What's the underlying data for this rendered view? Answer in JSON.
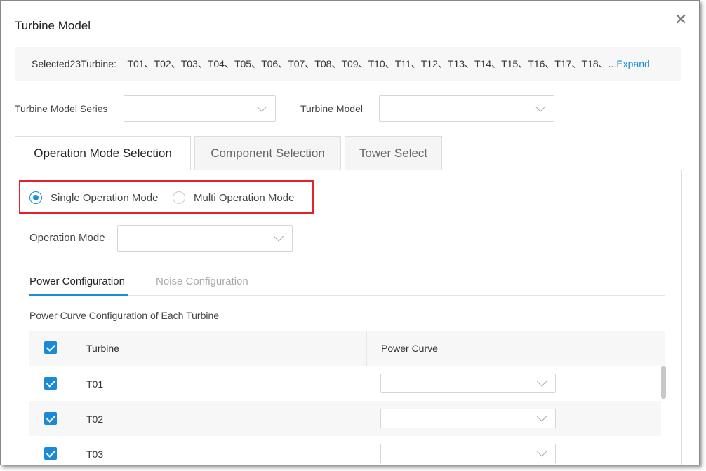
{
  "dialog": {
    "title": "Turbine Model",
    "close_icon": "close-icon"
  },
  "selected": {
    "label": "Selected23Turbine:",
    "turbines": "T01、T02、T03、T04、T05、T06、T07、T08、T09、T10、T11、T12、T13、T14、T15、T16、T17、T18、...",
    "expand": "Expand"
  },
  "filters": {
    "series_label": "Turbine Model Series",
    "series_value": "",
    "model_label": "Turbine Model",
    "model_value": ""
  },
  "tabs": [
    {
      "label": "Operation Mode Selection",
      "active": true
    },
    {
      "label": "Component Selection"
    },
    {
      "label": "Tower Select"
    }
  ],
  "mode": {
    "single": "Single Operation Mode",
    "multi": "Multi Operation Mode",
    "selected": "single",
    "op_label": "Operation Mode",
    "op_value": ""
  },
  "subtabs": [
    {
      "label": "Power Configuration",
      "active": true
    },
    {
      "label": "Noise Configuration"
    }
  ],
  "table": {
    "caption": "Power Curve Configuration of Each Turbine",
    "headers": [
      "Turbine",
      "Power Curve"
    ],
    "rows": [
      {
        "turbine": "T01",
        "curve": "",
        "checked": true
      },
      {
        "turbine": "T02",
        "curve": "",
        "checked": true
      },
      {
        "turbine": "T03",
        "curve": "",
        "checked": true
      }
    ]
  },
  "colors": {
    "accent": "#1890d8",
    "highlight": "#e3222b"
  }
}
